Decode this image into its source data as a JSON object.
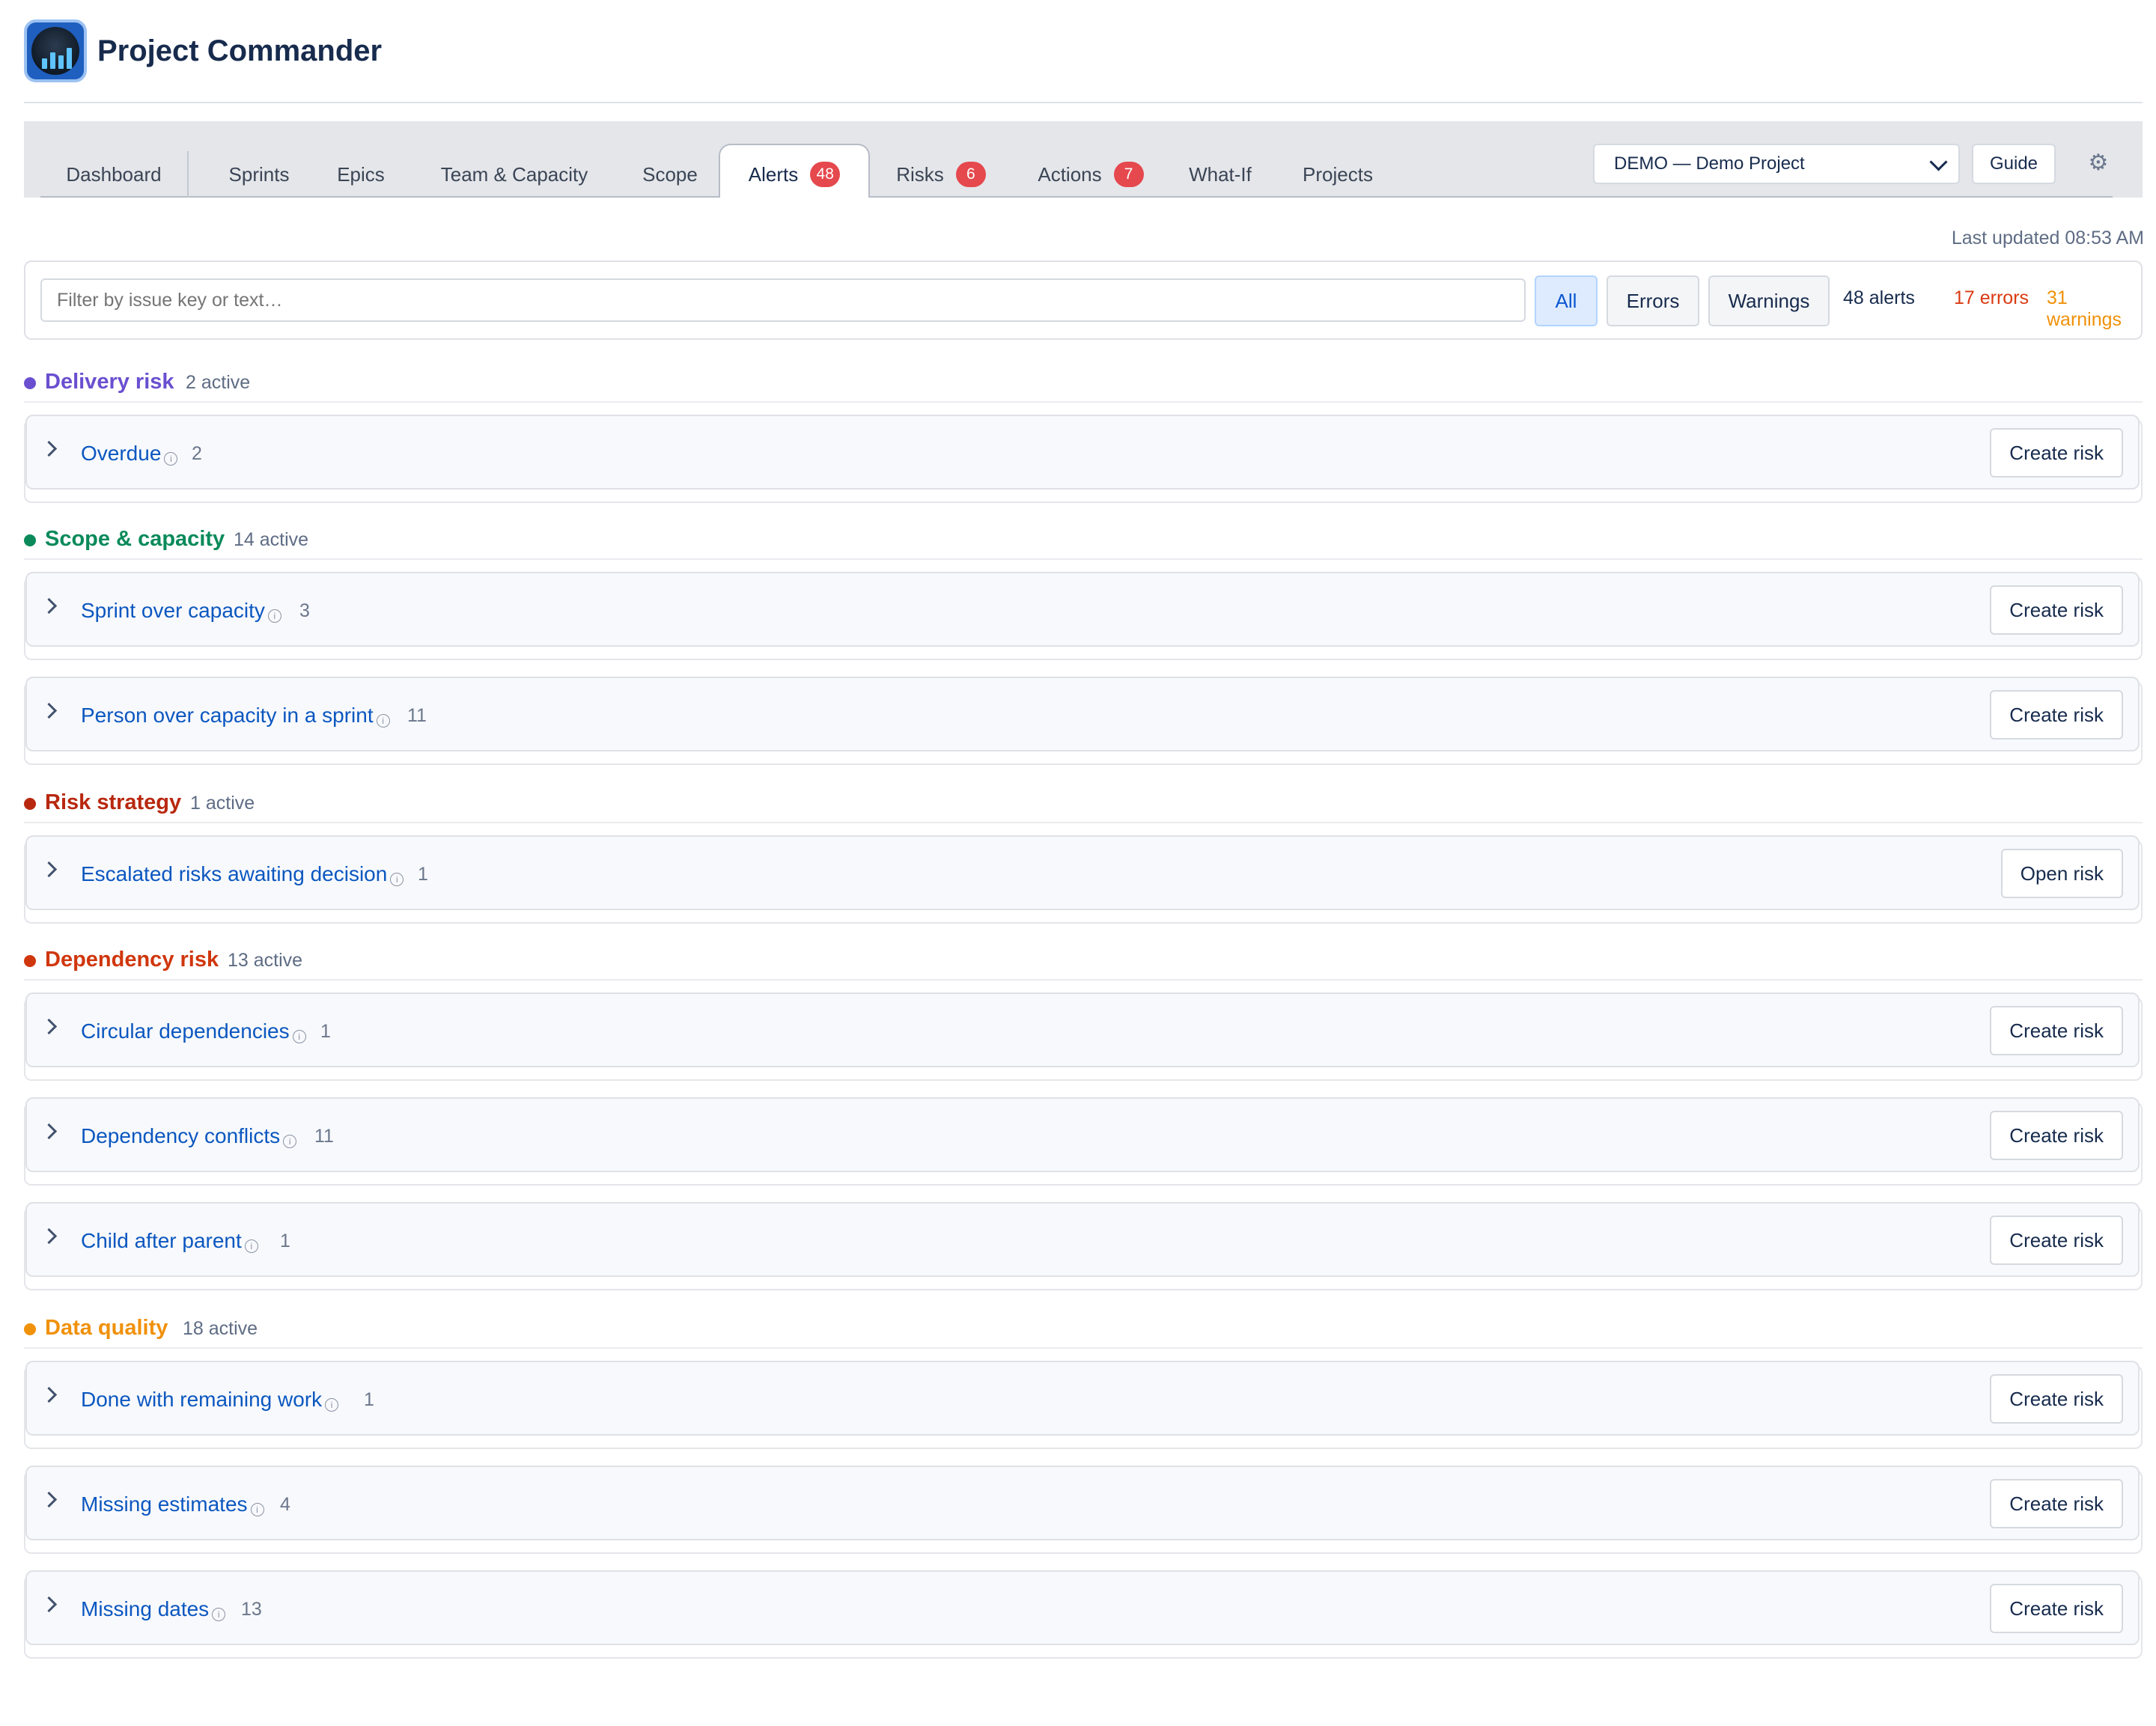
{
  "app": {
    "title": "Project Commander",
    "logo_icon": "radar-chart-icon"
  },
  "tabs": [
    {
      "label": "Dashboard",
      "badge": ""
    },
    {
      "label": "Sprints",
      "badge": ""
    },
    {
      "label": "Epics",
      "badge": ""
    },
    {
      "label": "Team & Capacity",
      "badge": ""
    },
    {
      "label": "Scope",
      "badge": ""
    },
    {
      "label": "Alerts",
      "badge": "48",
      "active": true
    },
    {
      "label": "Risks",
      "badge": "6"
    },
    {
      "label": "Actions",
      "badge": "7"
    },
    {
      "label": "What-If",
      "badge": ""
    },
    {
      "label": "Projects",
      "badge": ""
    }
  ],
  "toolbar": {
    "project_select": "DEMO — Demo Project",
    "guide_label": "Guide",
    "settings_icon": "gear-icon"
  },
  "last_updated": "Last updated 08:53 AM",
  "filter": {
    "placeholder": "Filter by issue key or text…",
    "segments": [
      "All",
      "Errors",
      "Warnings"
    ],
    "active_segment": "All",
    "alerts_count": "48 alerts",
    "errors_count": "17 errors",
    "warnings_count": "31 warnings"
  },
  "colors": {
    "errors": "#d93a12",
    "warnings": "#f0910a",
    "badge": "#e5484d",
    "link": "#0b57c0"
  },
  "sections": [
    {
      "title": "Delivery risk",
      "active": "2 active",
      "color": "#6a4fd0",
      "alerts": [
        {
          "title": "Overdue",
          "count": "2",
          "action": "Create risk"
        }
      ]
    },
    {
      "title": "Scope & capacity",
      "active": "14 active",
      "color": "#0a8a5a",
      "alerts": [
        {
          "title": "Sprint over capacity",
          "count": "3",
          "action": "Create risk"
        },
        {
          "title": "Person over capacity in a sprint",
          "count": "11",
          "action": "Create risk"
        }
      ]
    },
    {
      "title": "Risk strategy",
      "active": "1 active",
      "color": "#b8280f",
      "alerts": [
        {
          "title": "Escalated risks awaiting decision",
          "count": "1",
          "action": "Open risk"
        }
      ]
    },
    {
      "title": "Dependency risk",
      "active": "13 active",
      "color": "#d0360c",
      "alerts": [
        {
          "title": "Circular dependencies",
          "count": "1",
          "action": "Create risk"
        },
        {
          "title": "Dependency conflicts",
          "count": "11",
          "action": "Create risk"
        },
        {
          "title": "Child after parent",
          "count": "1",
          "action": "Create risk"
        }
      ]
    },
    {
      "title": "Data quality",
      "active": "18 active",
      "color": "#f0910a",
      "alerts": [
        {
          "title": "Done with remaining work",
          "count": "1",
          "action": "Create risk"
        },
        {
          "title": "Missing estimates",
          "count": "4",
          "action": "Create risk"
        },
        {
          "title": "Missing dates",
          "count": "13",
          "action": "Create risk"
        }
      ]
    }
  ]
}
